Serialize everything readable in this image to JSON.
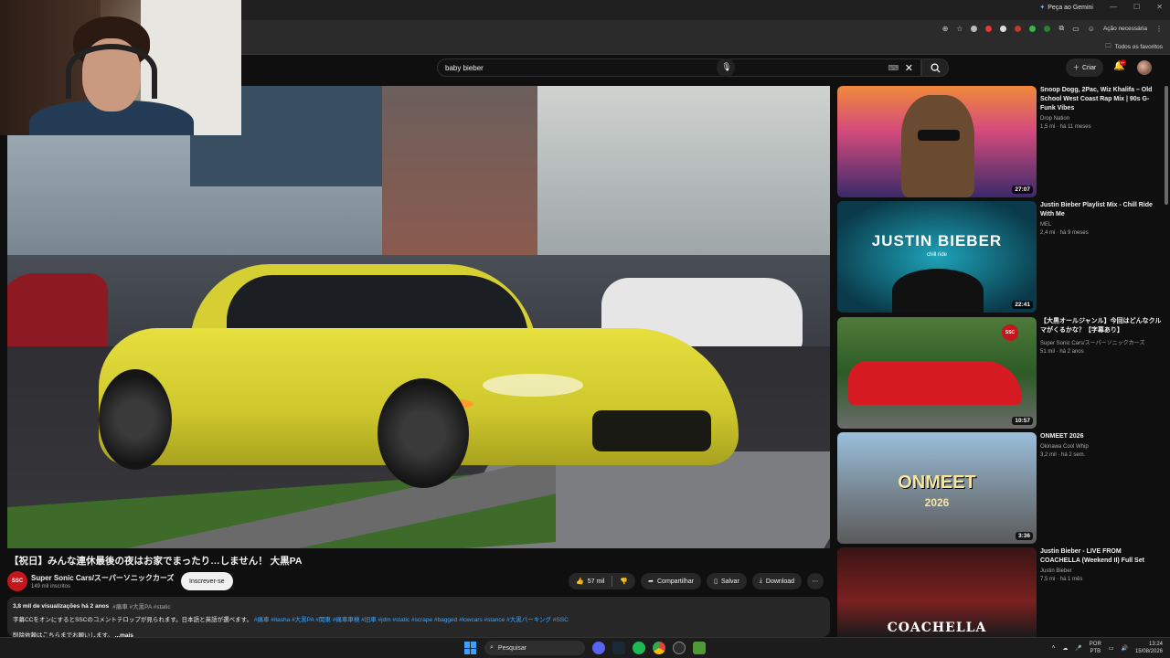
{
  "browser": {
    "gemini_label": "Peça ao Gemini",
    "action_needed": "Ação necessária",
    "bookmarks_all": "Todos os favoritos"
  },
  "youtube": {
    "search": {
      "query": "baby bieber"
    },
    "create_label": "Criar",
    "notif_count": "9+"
  },
  "video": {
    "title": "【祝日】みんな連休最後の夜はお家でまったり…しません！ 大黒PA",
    "channel": {
      "avatar_text": "SSC",
      "name": "Super Sonic Cars/スーパーソニックカーズ",
      "subscribers": "149 mil inscritos"
    },
    "subscribe_label": "Inscrever-se",
    "likes": "57 mil",
    "share_label": "Compartilhar",
    "save_label": "Salvar",
    "download_label": "Download",
    "description": {
      "stats": "3,8 mil de visualizações há 2 anos",
      "tags": "#痛車 #大黒PA #static",
      "line2": "字幕CCをオンにするとSSCのコメントテロップが見られます。日本語と英語が選べます。",
      "hashtags": "#痛車 #itasha #大黒PA #関東 #痛車車検 #旧車 #jdm #static #scrape #bagged #lowcars #stance #大黒パーキング #SSC",
      "line3": "削除依頼はこちらまでお願いします。",
      "more": "...mais"
    }
  },
  "recommendations": [
    {
      "title": "Snoop Dogg, 2Pac, Wiz Khalifa – Old School West Coast Rap Mix | 90s G-Funk Vibes",
      "channel": "Drop Nation",
      "meta": "1,5 mi · há 11 meses",
      "duration": "27:07"
    },
    {
      "title": "Justin Bieber Playlist Mix - Chill Ride With Me",
      "channel": "MEL",
      "meta": "2,4 mi · há 9 meses",
      "duration": "22:41",
      "thumb_text": "JUSTIN BIEBER",
      "thumb_sub": "chill ride"
    },
    {
      "title": "【大黒オールジャンル】今回はどんなクルマがくるかな？【字幕あり】",
      "channel": "Super Sonic Cars/スーパーソニックカーズ",
      "meta": "51 mil · há 2 anos",
      "duration": "10:57"
    },
    {
      "title": "ONMEET 2026",
      "channel": "Okinawa Cool Whip",
      "meta": "3,2 mil · há 2 sem.",
      "duration": "3:36",
      "thumb_text": "ONMEET",
      "thumb_sub": "2026"
    },
    {
      "title": "Justin Bieber - LIVE FROM COACHELLA (Weekend II) Full Set",
      "channel": "Justin Bieber",
      "meta": "7,5 mi · há 1 mês",
      "duration": "",
      "thumb_text": "COACHELLA"
    }
  ],
  "taskbar": {
    "search_label": "Pesquisar",
    "lang": "POR",
    "lang2": "PTB",
    "time": "13:24",
    "date": "15/08/2026"
  }
}
